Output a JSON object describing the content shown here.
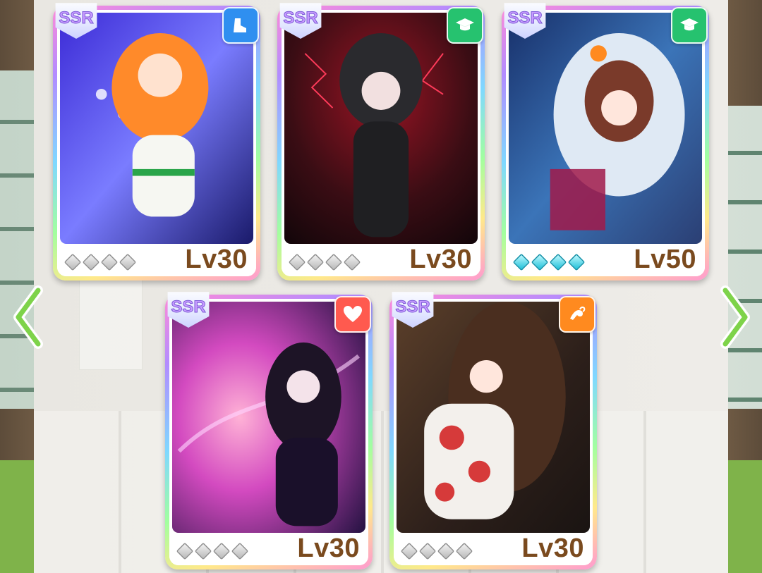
{
  "colors": {
    "speed_badge": "#2f8ff0",
    "wisdom_badge": "#26c26f",
    "friend_badge": "#ff5a4f",
    "power_badge": "#ff8a1f",
    "level_text": "#7a4a1e",
    "rarity_text": "#c89bff",
    "gem_filled": "#1fc0d8"
  },
  "cards": [
    {
      "rarity": "SSR",
      "type_icon": "shoe-icon",
      "level": "Lv30",
      "gems_filled": 0,
      "gems_total": 4,
      "art_theme": "orange-hair-stage"
    },
    {
      "rarity": "SSR",
      "type_icon": "graduation-cap-icon",
      "level": "Lv30",
      "gems_filled": 0,
      "gems_total": 4,
      "art_theme": "silver-hair-hooded-red-lightning"
    },
    {
      "rarity": "SSR",
      "type_icon": "graduation-cap-icon",
      "level": "Lv50",
      "gems_filled": 4,
      "gems_total": 4,
      "art_theme": "brown-hair-halloween-blue"
    },
    {
      "rarity": "SSR",
      "type_icon": "heart-icon",
      "level": "Lv30",
      "gems_filled": 0,
      "gems_total": 4,
      "art_theme": "dark-hair-purple-magic"
    },
    {
      "rarity": "SSR",
      "type_icon": "flexed-arm-icon",
      "level": "Lv30",
      "gems_filled": 0,
      "gems_total": 4,
      "art_theme": "brown-hair-kimono"
    }
  ],
  "navigation": {
    "prev_icon": "chevron-left-icon",
    "next_icon": "chevron-right-icon"
  }
}
